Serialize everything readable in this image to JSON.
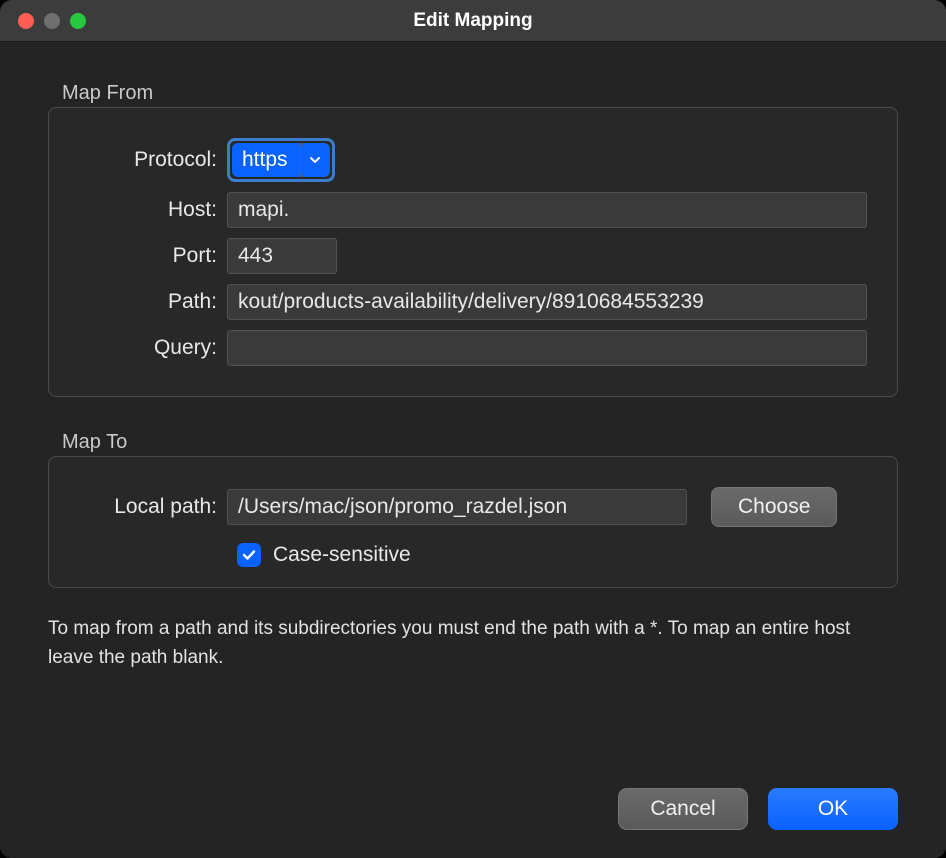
{
  "window": {
    "title": "Edit Mapping"
  },
  "map_from": {
    "legend": "Map From",
    "labels": {
      "protocol": "Protocol:",
      "host": "Host:",
      "port": "Port:",
      "path": "Path:",
      "query": "Query:"
    },
    "values": {
      "protocol": "https",
      "host": "mapi.",
      "port": "443",
      "path": "kout/products-availability/delivery/8910684553239",
      "query": ""
    }
  },
  "map_to": {
    "legend": "Map To",
    "labels": {
      "local_path": "Local path:"
    },
    "values": {
      "local_path": "/Users/mac/json/promo_razdel.json"
    },
    "choose_label": "Choose",
    "checkbox": {
      "checked": true,
      "label": "Case-sensitive"
    }
  },
  "hint": "To map from a path and its subdirectories you must end the path with a *. To map an entire host leave the path blank.",
  "footer": {
    "cancel": "Cancel",
    "ok": "OK"
  }
}
